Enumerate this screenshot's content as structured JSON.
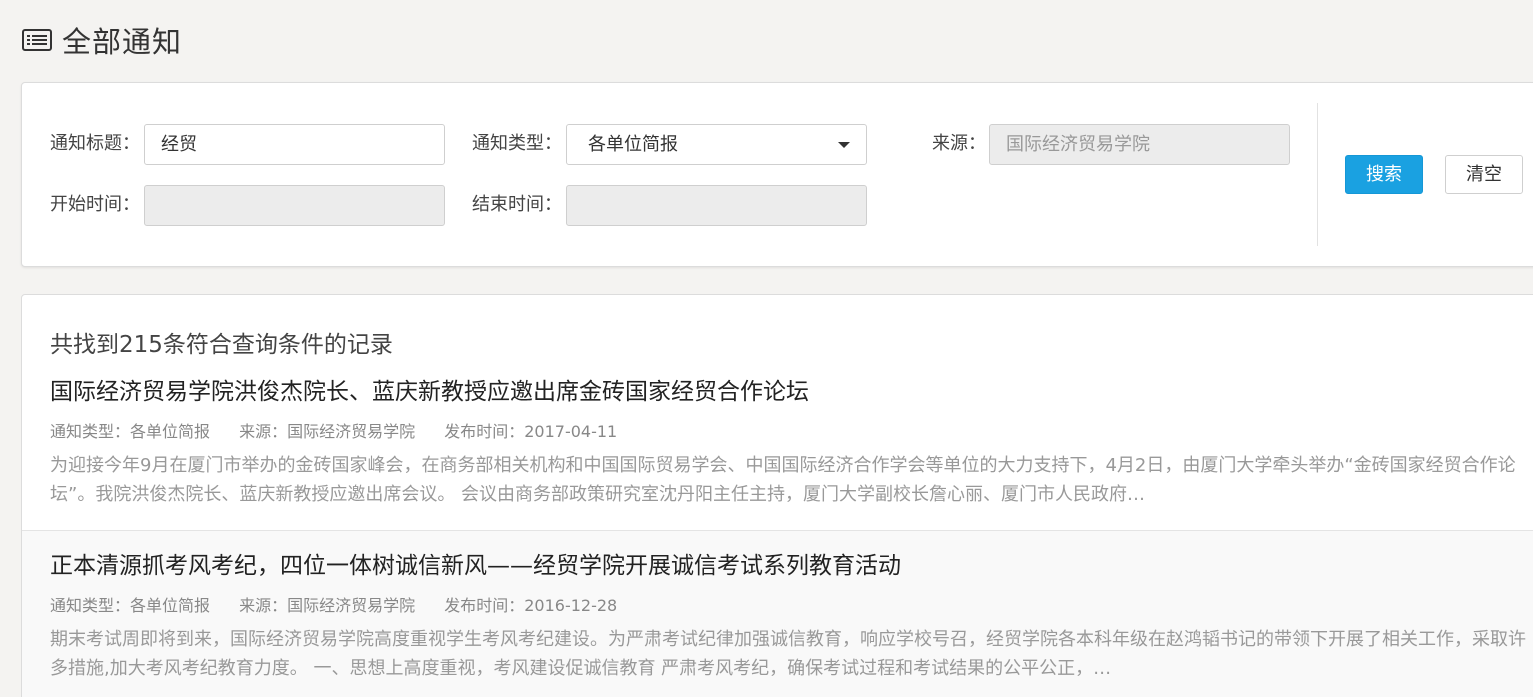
{
  "header": {
    "title": "全部通知",
    "icon": "list-icon"
  },
  "search": {
    "title_label": "通知标题：",
    "title_value": "经贸",
    "type_label": "通知类型：",
    "type_value": "各单位简报",
    "source_label": "来源：",
    "source_value": "国际经济贸易学院",
    "start_label": "开始时间：",
    "start_value": "",
    "end_label": "结束时间：",
    "end_value": "",
    "search_button": "搜索",
    "clear_button": "清空"
  },
  "results": {
    "count_text": "共找到215条符合查询条件的记录",
    "items": [
      {
        "title": "国际经济贸易学院洪俊杰院长、蓝庆新教授应邀出席金砖国家经贸合作论坛",
        "type": "通知类型：各单位简报",
        "source": "来源：国际经济贸易学院",
        "date": "发布时间：2017-04-11",
        "summary": "为迎接今年9月在厦门市举办的金砖国家峰会，在商务部相关机构和中国国际贸易学会、中国国际经济合作学会等单位的大力支持下，4月2日，由厦门大学牵头举办“金砖国家经贸合作论坛”。我院洪俊杰院长、蓝庆新教授应邀出席会议。 会议由商务部政策研究室沈丹阳主任主持，厦门大学副校长詹心丽、厦门市人民政府…"
      },
      {
        "title": "正本清源抓考风考纪，四位一体树诚信新风——经贸学院开展诚信考试系列教育活动",
        "type": "通知类型：各单位简报",
        "source": "来源：国际经济贸易学院",
        "date": "发布时间：2016-12-28",
        "summary": "期末考试周即将到来，国际经济贸易学院高度重视学生考风考纪建设。为严肃考试纪律加强诚信教育，响应学校号召，经贸学院各本科年级在赵鸿韬书记的带领下开展了相关工作，采取许多措施,加大考风考纪教育力度。 一、思想上高度重视，考风建设促诚信教育 严肃考风考纪，确保考试过程和考试结果的公平公正，…"
      }
    ]
  }
}
